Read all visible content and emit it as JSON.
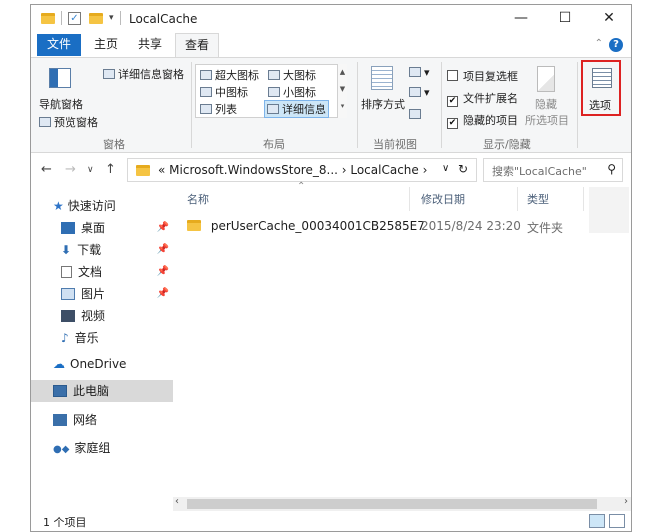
{
  "window": {
    "title": "LocalCache",
    "minimize": "—",
    "maximize": "☐",
    "close": "✕"
  },
  "tabs": [
    {
      "label": "文件"
    },
    {
      "label": "主页"
    },
    {
      "label": "共享"
    },
    {
      "label": "查看"
    }
  ],
  "ribbon": {
    "pane": {
      "nav_pane": "导航窗格",
      "preview_pane": "预览窗格",
      "details_pane": "详细信息窗格",
      "group": "窗格"
    },
    "layout": {
      "extra_large": "超大图标",
      "large": "大图标",
      "medium": "中图标",
      "small": "小图标",
      "list": "列表",
      "details": "详细信息",
      "group": "布局"
    },
    "current_view": {
      "sort_by": "排序方式",
      "group": "当前视图"
    },
    "show_hide": {
      "item_checkboxes": "项目复选框",
      "file_extensions": "文件扩展名",
      "hidden_items": "隐藏的项目",
      "hide": "隐藏",
      "selected_items": "所选项目",
      "group": "显示/隐藏"
    },
    "options": "选项"
  },
  "address": {
    "path": "« Microsoft.WindowsStore_8... › LocalCache ›",
    "search_placeholder": "搜索\"LocalCache\""
  },
  "nav": {
    "quick_access": "快速访问",
    "items": [
      {
        "label": "桌面",
        "pinned": true
      },
      {
        "label": "下载",
        "pinned": true
      },
      {
        "label": "文档",
        "pinned": true
      },
      {
        "label": "图片",
        "pinned": true
      },
      {
        "label": "视频",
        "pinned": false
      },
      {
        "label": "音乐",
        "pinned": false
      }
    ],
    "onedrive": "OneDrive",
    "this_pc": "此电脑",
    "network": "网络",
    "homegroup": "家庭组"
  },
  "columns": {
    "name": "名称",
    "modified": "修改日期",
    "type": "类型"
  },
  "files": [
    {
      "name": "perUserCache_00034001CB2585E7",
      "modified": "2015/8/24 23:20",
      "type": "文件夹"
    }
  ],
  "status": {
    "count": "1 个项目"
  },
  "colors": {
    "accent": "#1a6ec4",
    "highlight": "#d22222"
  }
}
